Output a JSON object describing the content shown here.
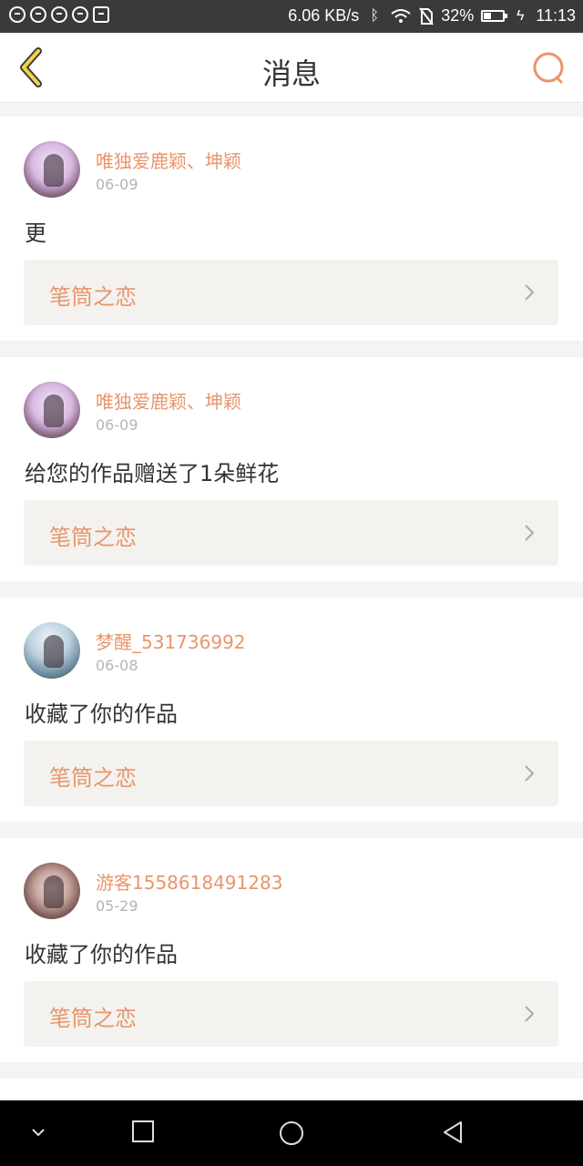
{
  "status_bar": {
    "net_speed": "6.06 KB/s",
    "battery": "32%",
    "time": "11:13",
    "icons": [
      "message-icon",
      "search-badge-icon",
      "app-icon",
      "app-icon-2",
      "image-icon",
      "bluetooth-icon",
      "wifi-icon",
      "no-sim-icon",
      "battery-icon",
      "charging-icon"
    ]
  },
  "header": {
    "title": "消息",
    "accent": "#e8956b",
    "back_icon": "chevron-left-icon",
    "search_icon": "search-icon"
  },
  "messages": [
    {
      "user": "唯独爱鹿颖、坤颖",
      "date": "06-09",
      "text": "更",
      "work": "笔筒之恋",
      "avatar": "av1"
    },
    {
      "user": "唯独爱鹿颖、坤颖",
      "date": "06-09",
      "text": "给您的作品赠送了1朵鲜花",
      "work": "笔筒之恋",
      "avatar": "av1"
    },
    {
      "user": "梦醒_531736992",
      "date": "06-08",
      "text": "收藏了你的作品",
      "work": "笔筒之恋",
      "avatar": "av2"
    },
    {
      "user": "游客1558618491283",
      "date": "05-29",
      "text": "收藏了你的作品",
      "work": "笔筒之恋",
      "avatar": "av3"
    }
  ],
  "nav_bar": {
    "icons": [
      "collapse-icon",
      "recent-apps-icon",
      "home-icon",
      "back-icon"
    ]
  }
}
